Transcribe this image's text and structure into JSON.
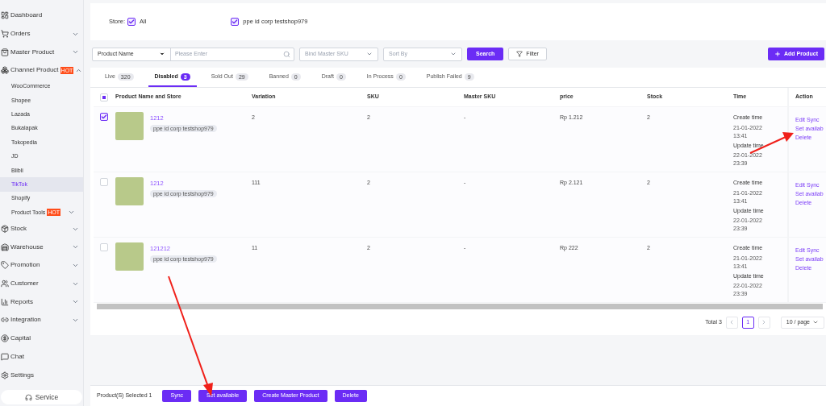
{
  "sidebar": {
    "items": [
      {
        "label": "Dashboard"
      },
      {
        "label": "Orders",
        "expanded": false
      },
      {
        "label": "Master Product",
        "expanded": false
      },
      {
        "label": "Channel Product",
        "badge": "HOT",
        "expanded": true,
        "children": [
          {
            "label": "WooCommerce",
            "selected": false
          },
          {
            "label": "Shopee",
            "selected": false
          },
          {
            "label": "Lazada",
            "selected": false
          },
          {
            "label": "Bukalapak",
            "selected": false
          },
          {
            "label": "Tokopedia",
            "selected": false
          },
          {
            "label": "JD",
            "selected": false
          },
          {
            "label": "Blibli",
            "selected": false
          },
          {
            "label": "TikTok",
            "selected": true
          },
          {
            "label": "Shopify",
            "selected": false
          },
          {
            "label": "Product Tools",
            "badge": "HOT",
            "expanded": false,
            "selected": false
          }
        ]
      },
      {
        "label": "Stock",
        "expanded": false
      },
      {
        "label": "Warehouse",
        "expanded": false
      },
      {
        "label": "Promotion",
        "expanded": false
      },
      {
        "label": "Customer",
        "expanded": false
      },
      {
        "label": "Reports",
        "expanded": false
      },
      {
        "label": "Integration",
        "expanded": false
      },
      {
        "label": "Capital"
      },
      {
        "label": "Chat"
      },
      {
        "label": "Settings"
      }
    ],
    "service_button": "Service"
  },
  "store_filter": {
    "label": "Store:",
    "options": [
      {
        "label": "All",
        "checked": true
      },
      {
        "label": "ppe id corp testshop979",
        "checked": true
      }
    ]
  },
  "toolbar": {
    "field_select": "Product Name",
    "search": {
      "placeholder": "Please Enter"
    },
    "master_sku": {
      "placeholder": "Bind Master SKU"
    },
    "sort": {
      "placeholder": "Sort By"
    },
    "search_button": "Search",
    "filter_button": "Filter",
    "add_button": "Add Product"
  },
  "tabs": [
    {
      "label": "Live",
      "count": "320",
      "selected": false
    },
    {
      "label": "Disabled",
      "count": "3",
      "selected": true
    },
    {
      "label": "Sold Out",
      "count": "29",
      "selected": false
    },
    {
      "label": "Banned",
      "count": "0",
      "selected": false
    },
    {
      "label": "Draft",
      "count": "0",
      "selected": false
    },
    {
      "label": "In Process",
      "count": "0",
      "selected": false
    },
    {
      "label": "Publish Failed",
      "count": "9",
      "selected": false
    }
  ],
  "table": {
    "select_all_indeterminate": true,
    "columns": [
      "Product Name and Store",
      "Variation",
      "SKU",
      "Master SKU",
      "price",
      "Stock",
      "Time",
      "Action"
    ],
    "rows": [
      {
        "checked": true,
        "name": "1212",
        "store": "ppe id corp testshop979",
        "variation": "2",
        "sku": "2",
        "master_sku": "-",
        "price": "Rp 1.212",
        "stock": "2",
        "times": [
          {
            "label": "Create time",
            "value": "21-01-2022 13:41"
          },
          {
            "label": "Update time",
            "value": "22-01-2022 23:39"
          }
        ],
        "actions": [
          "Edit Sync",
          "Set availab",
          "Delete"
        ]
      },
      {
        "checked": false,
        "name": "1212",
        "store": "ppe id corp testshop979",
        "variation": "111",
        "sku": "2",
        "master_sku": "-",
        "price": "Rp 2.121",
        "stock": "2",
        "times": [
          {
            "label": "Create time",
            "value": "21-01-2022 13:41"
          },
          {
            "label": "Update time",
            "value": "22-01-2022 23:39"
          }
        ],
        "actions": [
          "Edit Sync",
          "Set availab",
          "Delete"
        ]
      },
      {
        "checked": false,
        "name": "121212",
        "store": "ppe id corp testshop979",
        "variation": "11",
        "sku": "2",
        "master_sku": "-",
        "price": "Rp 222",
        "stock": "2",
        "times": [
          {
            "label": "Create time",
            "value": "21-01-2022 13:41"
          },
          {
            "label": "Update time",
            "value": "22-01-2022 23:39"
          }
        ],
        "actions": [
          "Edit Sync",
          "Set availab",
          "Delete"
        ]
      }
    ]
  },
  "pagination": {
    "total": "Total 3",
    "pages": [
      {
        "label": "1",
        "selected": true
      }
    ],
    "page_size": "10 / page"
  },
  "bottom_bar": {
    "selected_text": "Product(S) Selected 1",
    "buttons": [
      "Sync",
      "Set available",
      "Create Master Product",
      "Delete"
    ]
  }
}
